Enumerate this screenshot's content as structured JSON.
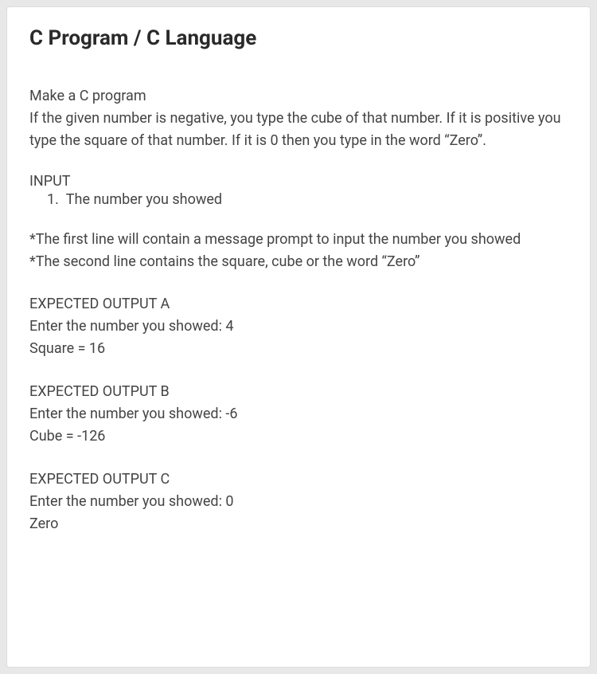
{
  "title": "C Program / C Language",
  "intro": {
    "line1": "Make a C program",
    "line2": "If the given number is negative, you type the cube of that number. If it is positive you type the square of that number. If it is 0 then you type in the word “Zero”."
  },
  "input": {
    "label": "INPUT",
    "item1": "1.  The number you showed"
  },
  "notes": {
    "n1": "*The first line will contain a message prompt to input the number you showed",
    "n2": "*The second line contains the square, cube or the word “Zero”"
  },
  "outputs": {
    "a": {
      "header": "EXPECTED OUTPUT A",
      "line1": "Enter the number you showed: 4",
      "line2": "Square = 16"
    },
    "b": {
      "header": "EXPECTED OUTPUT B",
      "line1": "Enter the number you showed: -6",
      "line2": "Cube = -126"
    },
    "c": {
      "header": "EXPECTED OUTPUT C",
      "line1": "Enter the number you showed: 0",
      "line2": "Zero"
    }
  }
}
